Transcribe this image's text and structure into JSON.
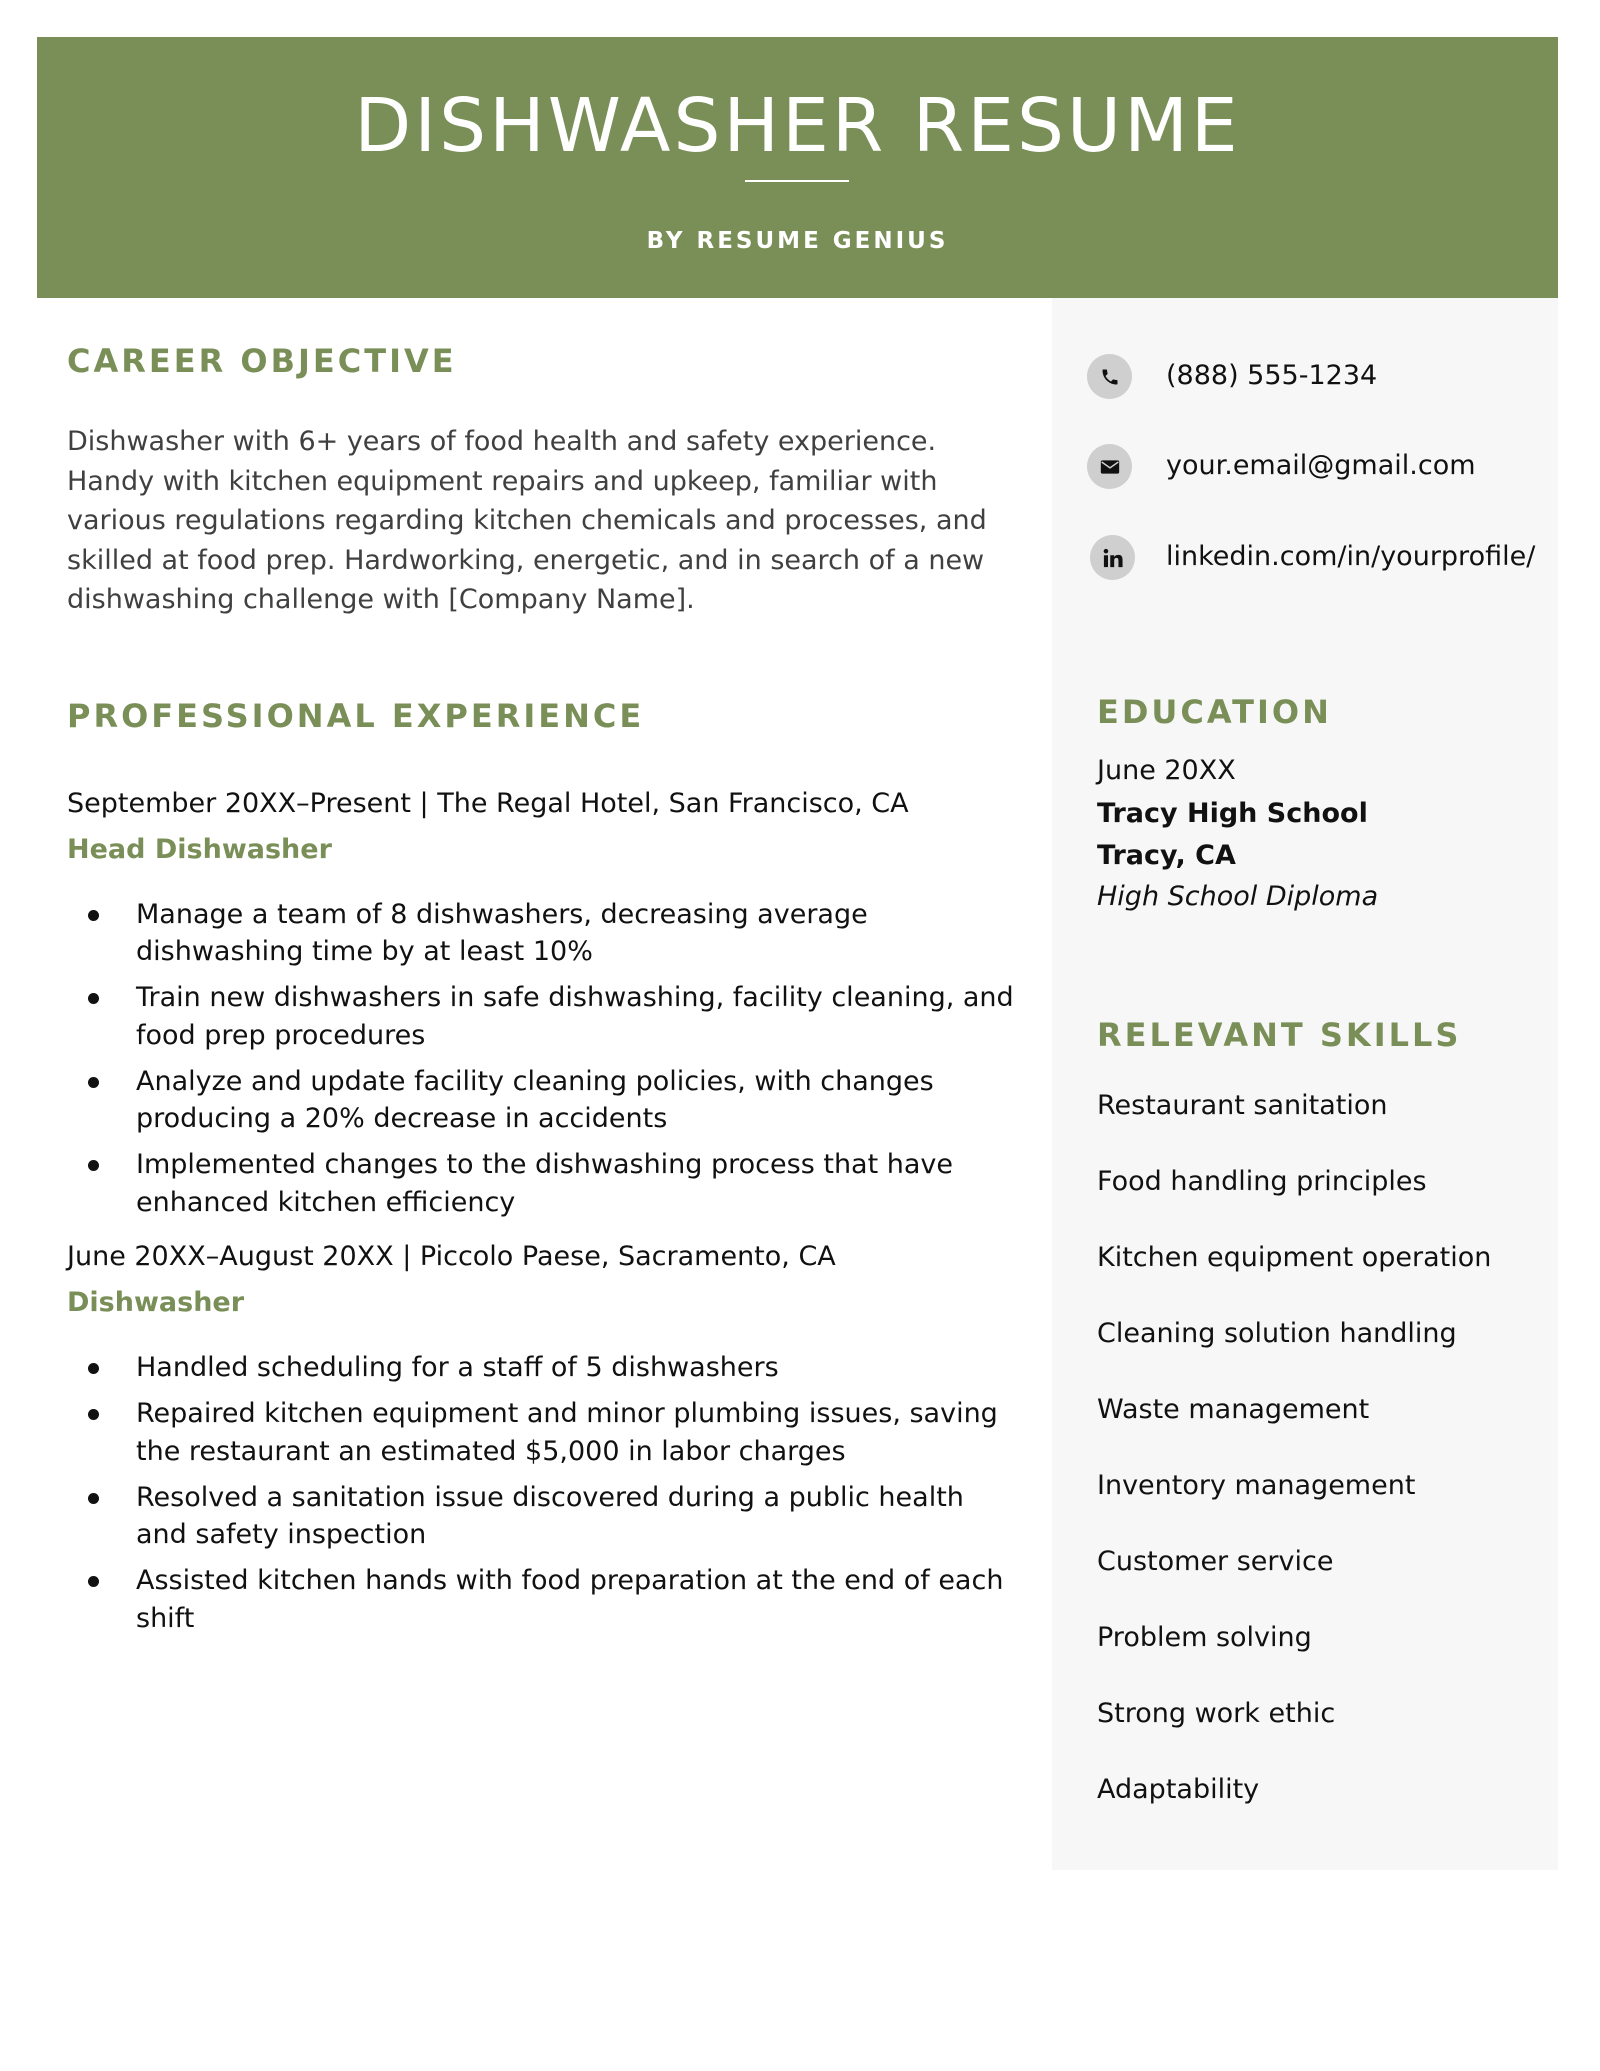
{
  "header": {
    "title": "DISHWASHER RESUME",
    "byline": "BY RESUME GENIUS"
  },
  "colors": {
    "accent": "#7a8f58",
    "sidebar_bg": "#f7f7f7",
    "icon_circle": "#cfcfcf"
  },
  "contact": [
    {
      "icon": "phone-icon",
      "text": "(888) 555-1234"
    },
    {
      "icon": "email-icon",
      "text": "your.email@gmail.com"
    },
    {
      "icon": "linkedin-icon",
      "text": "linkedin.com/in/yourprofile/"
    }
  ],
  "objective": {
    "heading": "CAREER OBJECTIVE",
    "text": "Dishwasher with 6+ years of food health and safety experience. Handy with kitchen equipment repairs and upkeep, familiar with various regulations regarding kitchen chemicals and processes, and skilled at food prep. Hardworking, energetic, and in search of a new dishwashing challenge with [Company Name]."
  },
  "experience": {
    "heading": "PROFESSIONAL EXPERIENCE",
    "jobs": [
      {
        "dates_location": "September 20XX–Present | The Regal Hotel, San Francisco, CA",
        "title": "Head Dishwasher",
        "bullets": [
          "Manage a team of 8 dishwashers, decreasing average dishwashing time by at least 10%",
          "Train new dishwashers in safe dishwashing, facility cleaning, and food prep procedures",
          "Analyze and update facility cleaning policies, with changes producing a 20% decrease in accidents",
          "Implemented changes to the dishwashing process that have enhanced kitchen efficiency"
        ]
      },
      {
        "dates_location": "June 20XX–August 20XX | Piccolo Paese, Sacramento, CA",
        "title": "Dishwasher",
        "bullets": [
          "Handled scheduling for a staff of 5 dishwashers",
          "Repaired kitchen equipment and minor plumbing issues, saving the restaurant an estimated $5,000 in labor charges",
          "Resolved a sanitation issue discovered during a public health and safety inspection",
          "Assisted kitchen hands with food preparation at the end of each shift"
        ]
      }
    ]
  },
  "education": {
    "heading": "EDUCATION",
    "date": "June 20XX",
    "school": "Tracy High School",
    "location": "Tracy, CA",
    "degree": "High School Diploma"
  },
  "skills": {
    "heading": "RELEVANT SKILLS",
    "items": [
      "Restaurant sanitation",
      "Food handling principles",
      "Kitchen equipment operation",
      "Cleaning solution handling",
      "Waste management",
      "Inventory management",
      "Customer service",
      "Problem solving",
      "Strong work ethic",
      "Adaptability"
    ]
  }
}
